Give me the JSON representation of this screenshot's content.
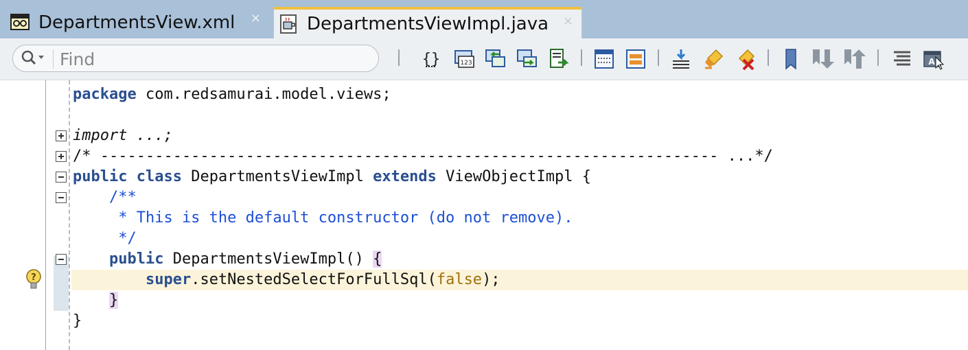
{
  "tabs": [
    {
      "label": "DepartmentsView.xml",
      "icon": "xml-file-icon",
      "active": false,
      "close": "×"
    },
    {
      "label": "DepartmentsViewImpl.java",
      "icon": "java-file-icon",
      "active": true,
      "close": "×"
    }
  ],
  "toolbar": {
    "find_placeholder": "Find",
    "find_value": "",
    "buttons": [
      "code-template-icon",
      "goto-line-icon",
      "previous-edit-icon",
      "next-edit-icon",
      "goto-source-icon",
      "toggle-comment-icon",
      "reformat-icon",
      "show-imports-icon",
      "highlight-icon",
      "clear-highlight-icon",
      "toggle-bookmark-icon",
      "next-bookmark-icon",
      "previous-bookmark-icon",
      "outline-icon",
      "code-assist-icon"
    ]
  },
  "code": {
    "l1_kw": "package",
    "l1_rest": " com.redsamurai.model.views;",
    "l3": "import ...;",
    "l4": "/* -------------------------------------------------------------------- ...*/",
    "l5_kw1": "public",
    "l5_sp1": " ",
    "l5_kw2": "class",
    "l5_name": " DepartmentsViewImpl ",
    "l5_kw3": "extends",
    "l5_rest": " ViewObjectImpl {",
    "l6": "    /**",
    "l7": "     * This is the default constructor (do not remove).",
    "l8": "     */",
    "l9_indent": "    ",
    "l9_kw": "public",
    "l9_rest": " DepartmentsViewImpl() ",
    "l9_brace": "{",
    "l10_indent": "        ",
    "l10_kw": "super",
    "l10_call": ".setNestedSelectForFullSql(",
    "l10_lit": "false",
    "l10_end": ");",
    "l11_indent": "    ",
    "l11_brace": "}",
    "l12": "}"
  },
  "colors": {
    "tabbar": "#a8c0d8",
    "active_tab_accent": "#f0c040",
    "keyword": "#2a4f8f",
    "javadoc": "#1d4fd6",
    "literal": "#a0700e",
    "current_line": "#fcf4da",
    "brace_match": "#ecd7f2"
  }
}
